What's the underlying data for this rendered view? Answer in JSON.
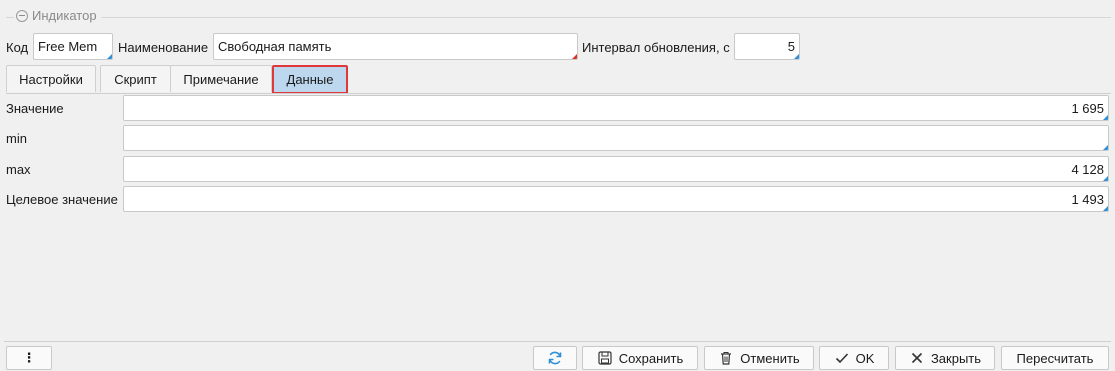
{
  "group": {
    "title": "Индикатор"
  },
  "header": {
    "code_label": "Код",
    "code_value": "Free Mem",
    "name_label": "Наименование",
    "name_value": "Свободная память",
    "interval_label": "Интервал обновления, с",
    "interval_value": "5"
  },
  "tabs": [
    {
      "label": "Настройки"
    },
    {
      "label": "Скрипт"
    },
    {
      "label": "Примечание"
    },
    {
      "label": "Данные",
      "active": true
    }
  ],
  "data_rows": [
    {
      "label": "Значение",
      "value": "1 695"
    },
    {
      "label": "min",
      "value": ""
    },
    {
      "label": "max",
      "value": "4 128"
    },
    {
      "label": "Целевое значение",
      "value": "1 493"
    }
  ],
  "buttons": {
    "more_label": "⋮",
    "refresh_icon": "refresh-icon",
    "save_label": "Сохранить",
    "cancel_label": "Отменить",
    "ok_label": "OK",
    "close_label": "Закрыть",
    "recalc_label": "Пересчитать"
  },
  "colors": {
    "accent": "#2f8fd8",
    "required": "#d9302a",
    "active_tab": "#bdd7ee",
    "highlight": "#e0383a"
  }
}
